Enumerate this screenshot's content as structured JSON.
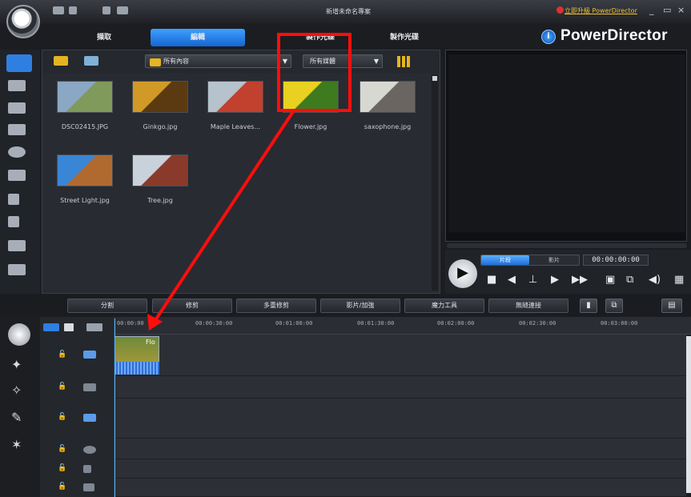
{
  "title_bar": {
    "app_title": "新增未命名專案",
    "upgrade_link": "立即升級 PowerDirector",
    "controls": [
      "_",
      "▭",
      "×"
    ]
  },
  "mode_tabs": [
    {
      "label": "擷取",
      "active": false
    },
    {
      "label": "編輯",
      "active": true
    },
    {
      "label": "製作光碟",
      "active": false
    },
    {
      "label": "製作光碟",
      "active": false
    }
  ],
  "brand": "PowerDirector",
  "library": {
    "filter_media": "所有內容",
    "filter_type": "所有媒體",
    "items": [
      {
        "label": "DSC02415.JPG",
        "colors": [
          "#8aa7c4",
          "#7f9a5a"
        ]
      },
      {
        "label": "Ginkgo.jpg",
        "colors": [
          "#d19a26",
          "#5b3a12"
        ]
      },
      {
        "label": "Maple Leaves...",
        "colors": [
          "#b6c2cc",
          "#c2402e"
        ]
      },
      {
        "label": "Flower.jpg",
        "colors": [
          "#e8d120",
          "#3e7a1e"
        ]
      },
      {
        "label": "saxophone.jpg",
        "colors": [
          "#d8d8d2",
          "#6a6560"
        ]
      },
      {
        "label": "Street Light.jpg",
        "colors": [
          "#3a86d6",
          "#b06a30"
        ]
      },
      {
        "label": "Tree.jpg",
        "colors": [
          "#c9d1da",
          "#8a3a2a"
        ]
      }
    ]
  },
  "preview": {
    "mode_clip": "片段",
    "mode_movie": "影片",
    "timecode": "00:00:00:00"
  },
  "action_bar": [
    "分割",
    "修剪",
    "多重修剪",
    "影片/加強",
    "魔力工具",
    "無縫連接"
  ],
  "timeline": {
    "ruler": [
      "00:00:00",
      "00:00:30:00",
      "00:01:00:00",
      "00:01:30:00",
      "00:02:00:00",
      "00:02:30:00",
      "00:03:00:00"
    ],
    "clip_label": "Flo"
  },
  "annotation": {
    "color": "#ff0d0d"
  }
}
